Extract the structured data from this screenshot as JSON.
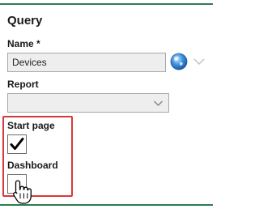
{
  "header": {
    "title": "Query"
  },
  "form": {
    "name": {
      "label": "Name *",
      "value": "Devices",
      "globe_icon": "globe-icon",
      "chevron_icon": "chevron-down-icon"
    },
    "report": {
      "label": "Report",
      "selected_value": "",
      "chevron_icon": "chevron-down-icon"
    },
    "start_page": {
      "label": "Start page",
      "checked": true
    },
    "dashboard": {
      "label": "Dashboard",
      "checked": false
    }
  },
  "colors": {
    "rule": "#2e7d4f",
    "highlight": "#d9383b",
    "input_background": "#eeeeee",
    "input_border": "#a9a9a9"
  },
  "icons": {
    "checkmark": "checkmark-icon",
    "cursor": "hand-pointer-cursor-icon"
  }
}
